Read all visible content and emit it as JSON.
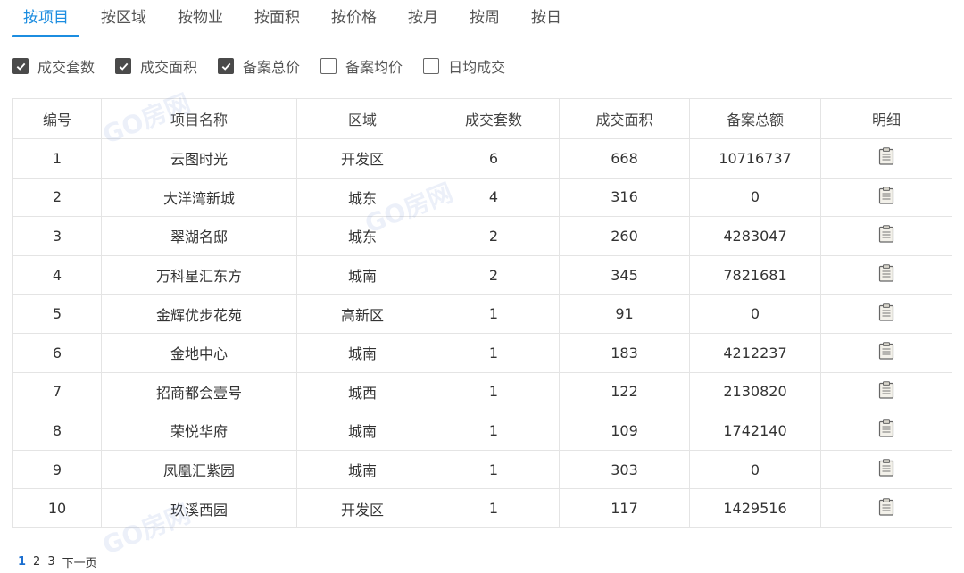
{
  "tabs": [
    {
      "label": "按项目",
      "active": true
    },
    {
      "label": "按区域",
      "active": false
    },
    {
      "label": "按物业",
      "active": false
    },
    {
      "label": "按面积",
      "active": false
    },
    {
      "label": "按价格",
      "active": false
    },
    {
      "label": "按月",
      "active": false
    },
    {
      "label": "按周",
      "active": false
    },
    {
      "label": "按日",
      "active": false
    }
  ],
  "filters": [
    {
      "label": "成交套数",
      "checked": true
    },
    {
      "label": "成交面积",
      "checked": true
    },
    {
      "label": "备案总价",
      "checked": true
    },
    {
      "label": "备案均价",
      "checked": false
    },
    {
      "label": "日均成交",
      "checked": false
    }
  ],
  "table": {
    "headers": [
      "编号",
      "项目名称",
      "区域",
      "成交套数",
      "成交面积",
      "备案总额",
      "明细"
    ],
    "rows": [
      [
        "1",
        "云图时光",
        "开发区",
        "6",
        "668",
        "10716737"
      ],
      [
        "2",
        "大洋湾新城",
        "城东",
        "4",
        "316",
        "0"
      ],
      [
        "3",
        "翠湖名邸",
        "城东",
        "2",
        "260",
        "4283047"
      ],
      [
        "4",
        "万科星汇东方",
        "城南",
        "2",
        "345",
        "7821681"
      ],
      [
        "5",
        "金辉优步花苑",
        "高新区",
        "1",
        "91",
        "0"
      ],
      [
        "6",
        "金地中心",
        "城南",
        "1",
        "183",
        "4212237"
      ],
      [
        "7",
        "招商都会壹号",
        "城西",
        "1",
        "122",
        "2130820"
      ],
      [
        "8",
        "荣悦华府",
        "城南",
        "1",
        "109",
        "1742140"
      ],
      [
        "9",
        "凤凰汇紫园",
        "城南",
        "1",
        "303",
        "0"
      ],
      [
        "10",
        "玖溪西园",
        "开发区",
        "1",
        "117",
        "1429516"
      ]
    ],
    "detail_icon": "clipboard-icon"
  },
  "watermark_text": "GO房网",
  "pagination": {
    "pages": [
      "1",
      "2",
      "3"
    ],
    "current": "1",
    "next_label": "下一页"
  },
  "colors": {
    "accent": "#1c8de0",
    "text": "#333333",
    "border": "#e4e4e4"
  }
}
